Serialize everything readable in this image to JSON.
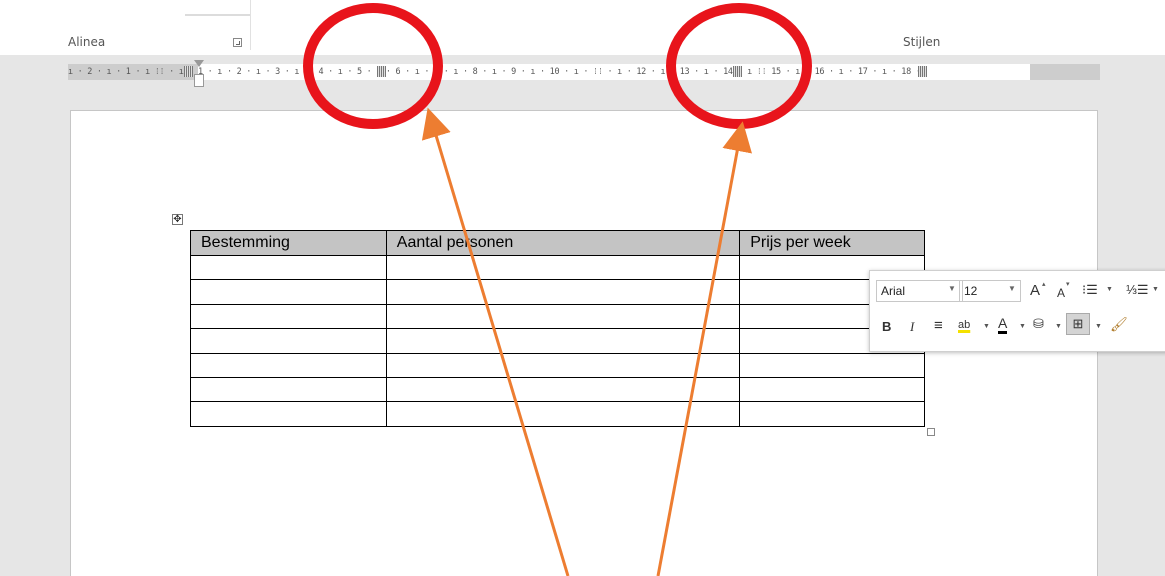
{
  "ribbon": {
    "groups": [
      {
        "label": "Alinea"
      },
      {
        "label": "Stijlen"
      }
    ]
  },
  "ruler": {
    "text": "ı · 2 · ı · 1 · ı  ⁞⁞  · ı · 1 · ı · 2 · ı · 3 · ı  ⁞⁞ 4 · ı · 5 · ı · 6 · ı · 7 · ı · 8 · ı · 9 · ı · 10 · ı ·  ⁞⁞  · ı · 12 · ı · 13 · ı · 14 · ı  ⁞⁞ 15 · ı · 16 · ı · 17 · ı · 18 ·"
  },
  "table": {
    "headers": [
      "Bestemming",
      "Aantal personen",
      "Prijs per week"
    ],
    "empty_rows": 7
  },
  "mini_toolbar": {
    "font": "Arial",
    "size": "12",
    "grow_font": "A",
    "shrink_font": "A",
    "bold": "B",
    "italic": "I",
    "font_color": "A",
    "highlight": "ab"
  },
  "annotations": {
    "circle_color": "#e8141b",
    "arrow_color": "#ed7d31"
  }
}
